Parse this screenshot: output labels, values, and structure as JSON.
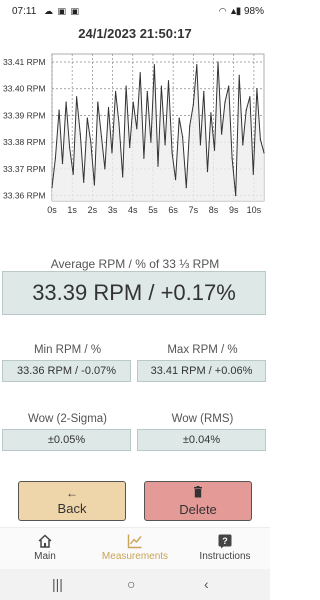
{
  "status_bar": {
    "time": "07:11",
    "left_icons": [
      "cloud-icon",
      "gallery-icon",
      "gallery-icon"
    ],
    "right_icons": [
      "wifi-icon",
      "signal-icon"
    ],
    "battery": "98%"
  },
  "header": {
    "timestamp": "24/1/2023 21:50:17"
  },
  "chart_data": {
    "type": "line",
    "y_ticks": [
      "33.41 RPM",
      "33.40 RPM",
      "33.39 RPM",
      "33.38 RPM",
      "33.37 RPM",
      "33.36 RPM"
    ],
    "x_ticks": [
      "0s",
      "1s",
      "2s",
      "3s",
      "4s",
      "5s",
      "6s",
      "7s",
      "8s",
      "9s",
      "10s"
    ],
    "ylim": [
      33.358,
      33.413
    ],
    "xlim": [
      0,
      10.5
    ],
    "grid": true,
    "x": [
      0,
      0.17,
      0.35,
      0.52,
      0.7,
      0.87,
      1.05,
      1.22,
      1.4,
      1.57,
      1.75,
      1.92,
      2.1,
      2.27,
      2.45,
      2.62,
      2.8,
      2.97,
      3.15,
      3.32,
      3.5,
      3.67,
      3.85,
      4.02,
      4.2,
      4.37,
      4.55,
      4.72,
      4.9,
      5.07,
      5.25,
      5.42,
      5.6,
      5.77,
      5.95,
      6.12,
      6.3,
      6.47,
      6.65,
      6.82,
      7.0,
      7.17,
      7.35,
      7.52,
      7.7,
      7.87,
      8.05,
      8.22,
      8.4,
      8.57,
      8.75,
      8.92,
      9.1,
      9.27,
      9.45,
      9.62,
      9.8,
      9.97,
      10.15,
      10.32,
      10.5
    ],
    "values": [
      33.363,
      33.374,
      33.392,
      33.372,
      33.395,
      33.378,
      33.368,
      33.397,
      33.383,
      33.365,
      33.389,
      33.38,
      33.364,
      33.395,
      33.382,
      33.37,
      33.393,
      33.376,
      33.399,
      33.387,
      33.367,
      33.401,
      33.378,
      33.395,
      33.385,
      33.406,
      33.374,
      33.399,
      33.38,
      33.409,
      33.371,
      33.401,
      33.379,
      33.403,
      33.376,
      33.366,
      33.389,
      33.382,
      33.363,
      33.386,
      33.394,
      33.409,
      33.379,
      33.399,
      33.369,
      33.391,
      33.377,
      33.41,
      33.383,
      33.395,
      33.401,
      33.374,
      33.36,
      33.405,
      33.379,
      33.392,
      33.397,
      33.368,
      33.4,
      33.381,
      33.376
    ]
  },
  "average": {
    "label": "Average RPM / % of 33 ⅓ RPM",
    "value": "33.39 RPM / +0.17%"
  },
  "min": {
    "label": "Min RPM / %",
    "value": "33.36 RPM / -0.07%"
  },
  "max": {
    "label": "Max RPM / %",
    "value": "33.41 RPM / +0.06%"
  },
  "wow_sigma": {
    "label": "Wow (2-Sigma)",
    "value": "±0.05%"
  },
  "wow_rms": {
    "label": "Wow (RMS)",
    "value": "±0.04%"
  },
  "buttons": {
    "back": {
      "label": "Back",
      "icon": "arrow-left-icon"
    },
    "delete": {
      "label": "Delete",
      "icon": "trash-icon"
    }
  },
  "bottom_nav": {
    "items": [
      {
        "label": "Main",
        "icon": "home-icon"
      },
      {
        "label": "Measurements",
        "icon": "chart-icon"
      },
      {
        "label": "Instructions",
        "icon": "help-icon"
      }
    ],
    "active_index": 1,
    "active_color": "#c9a45a"
  },
  "colors": {
    "value_box": "#dde8e7",
    "back_button": "#efd6aa",
    "delete_button": "#e49b97",
    "line": "#333333",
    "fill": "#eeeeee"
  }
}
